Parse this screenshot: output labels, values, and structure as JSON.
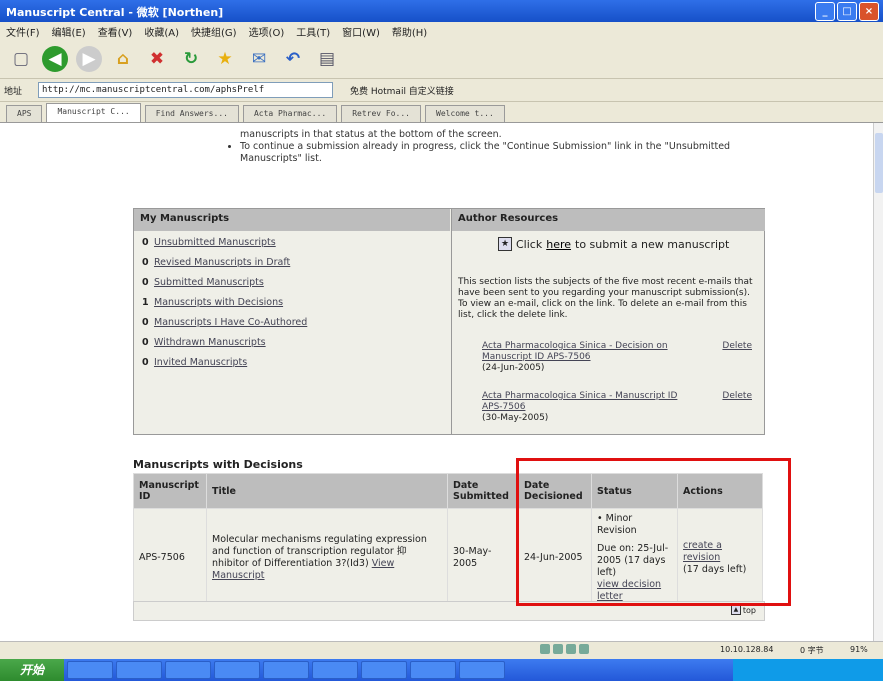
{
  "window": {
    "title": "Manuscript Central - 微软 [Northen]",
    "buttons": [
      "_",
      "□",
      "×"
    ]
  },
  "menu": [
    "文件(F)",
    "编辑(E)",
    "查看(V)",
    "收藏(A)",
    "快捷组(G)",
    "选项(O)",
    "工具(T)",
    "窗口(W)",
    "帮助(H)"
  ],
  "toolbar": {
    "icons": [
      "new-icon",
      "back-icon",
      "forward-icon",
      "home-icon",
      "stop-icon",
      "refresh-icon",
      "favorites-icon",
      "mail-icon",
      "undo-icon",
      "window-icon"
    ]
  },
  "address": {
    "label": "地址",
    "url": "http://mc.manuscriptcentral.com/aphsPrelf",
    "extra": "免费 Hotmail   自定义链接"
  },
  "tabs": [
    "APS",
    "Manuscript C...",
    "Find Answers...",
    "Acta Pharmac...",
    "Retrev Fo...",
    "Welcome t..."
  ],
  "intro": {
    "line1": "manuscripts in that status at the bottom of the screen.",
    "line2": "To continue a submission already in progress, click the \"Continue Submission\" link in the \"Unsubmitted Manuscripts\" list."
  },
  "my_manuscripts": {
    "title": "My Manuscripts",
    "items": [
      {
        "count": "0",
        "label": "Unsubmitted Manuscripts"
      },
      {
        "count": "0",
        "label": "Revised Manuscripts in Draft"
      },
      {
        "count": "0",
        "label": "Submitted Manuscripts"
      },
      {
        "count": "1",
        "label": "Manuscripts with Decisions"
      },
      {
        "count": "0",
        "label": "Manuscripts I Have Co-Authored"
      },
      {
        "count": "0",
        "label": "Withdrawn Manuscripts"
      },
      {
        "count": "0",
        "label": "Invited Manuscripts"
      }
    ]
  },
  "author_resources": {
    "title": "Author Resources",
    "submit_pre": "Click",
    "submit_link": "here",
    "submit_post": "to submit a new manuscript",
    "description": "This section lists the subjects of the five most recent e-mails that have been sent to you regarding your manuscript submission(s). To view an e-mail, click on the link. To delete an e-mail from this list, click the delete link.",
    "emails": [
      {
        "subject": "Acta Pharmacologica Sinica - Decision on Manuscript ID APS-7506",
        "date": "(24-Jun-2005)",
        "delete": "Delete"
      },
      {
        "subject": "Acta Pharmacologica Sinica - Manuscript ID APS-7506",
        "date": "(30-May-2005)",
        "delete": "Delete"
      }
    ]
  },
  "decisions": {
    "title": "Manuscripts with Decisions",
    "headers": [
      "Manuscript ID",
      "Title",
      "Date Submitted",
      "Date Decisioned",
      "Status",
      "Actions"
    ],
    "row": {
      "id": "APS-7506",
      "title": "Molecular mechanisms regulating expression and function of transcription regulator 抑 nhibitor of Differentiation 3?(Id3)",
      "view_link": "View Manuscript",
      "submitted": "30-May-2005",
      "decisioned": "24-Jun-2005",
      "status_label": "• Minor Revision",
      "due": "Due on: 25-Jul-2005 (17 days left)",
      "view_decision": "view decision letter",
      "action_link": "create a revision",
      "action_left": "(17 days left)"
    },
    "top_label": "top"
  },
  "statusbar": {
    "ip": "10.10.128.84",
    "zone": "0 字节",
    "pct": "91%"
  },
  "taskbar": {
    "start": "开始"
  }
}
